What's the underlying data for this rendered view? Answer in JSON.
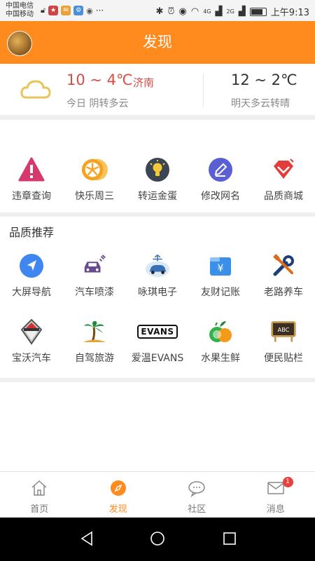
{
  "status_bar": {
    "carrier_1": "中国电信",
    "carrier_2": "中国移动",
    "more": "···",
    "net_1": "4G",
    "net_2": "2G",
    "time": "上午9:13"
  },
  "header": {
    "title": "发现"
  },
  "weather": {
    "today_temp": "10 ~ 4℃",
    "city": "济南",
    "today_desc": "今日 阴转多云",
    "tomorrow_temp": "12 ~ 2℃",
    "tomorrow_desc": "明天多云转晴"
  },
  "quick_services": [
    {
      "label": "违章查询",
      "icon": "warning-icon"
    },
    {
      "label": "快乐周三",
      "icon": "orange-slice-icon"
    },
    {
      "label": "转运金蛋",
      "icon": "lightbulb-icon"
    },
    {
      "label": "修改网名",
      "icon": "pencil-icon"
    },
    {
      "label": "品质商城",
      "icon": "diamond-icon"
    }
  ],
  "recommend": {
    "title": "品质推荐",
    "row1": [
      {
        "label": "大屏导航",
        "icon": "navigation-icon"
      },
      {
        "label": "汽车喷漆",
        "icon": "car-paint-icon"
      },
      {
        "label": "咏琪电子",
        "icon": "car-electronics-icon"
      },
      {
        "label": "友财记账",
        "icon": "wallet-icon"
      },
      {
        "label": "老路养车",
        "icon": "tools-icon"
      }
    ],
    "row2": [
      {
        "label": "宝沃汽车",
        "icon": "borgward-logo-icon"
      },
      {
        "label": "自驾旅游",
        "icon": "palm-tree-icon"
      },
      {
        "label": "爱温EVANS",
        "icon": "evans-logo-icon",
        "logo_text": "EVANS"
      },
      {
        "label": "水果生鲜",
        "icon": "fruit-icon"
      },
      {
        "label": "便民贴栏",
        "icon": "board-icon",
        "board_text": "ABC"
      }
    ]
  },
  "tabs": [
    {
      "label": "首页",
      "icon": "home-icon"
    },
    {
      "label": "发现",
      "icon": "compass-icon",
      "active": true
    },
    {
      "label": "社区",
      "icon": "chat-bubble-icon"
    },
    {
      "label": "消息",
      "icon": "mail-icon",
      "badge": "1"
    }
  ],
  "colors": {
    "brand": "#ff8a1e",
    "accent_red": "#d94b45",
    "badge": "#e8413b"
  },
  "battery_level": 0.85
}
